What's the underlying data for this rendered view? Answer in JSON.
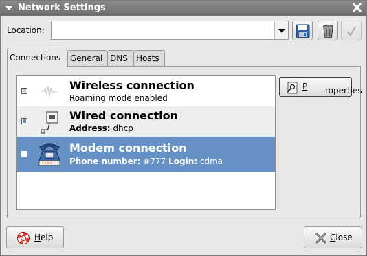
{
  "window": {
    "title": "Network Settings"
  },
  "location": {
    "label": "Location:",
    "value": ""
  },
  "toolbar": {
    "save_icon": "floppy-disk-icon",
    "delete_icon": "trash-can-icon",
    "apply_icon": "checkmark-icon"
  },
  "tabs": [
    {
      "label": "Connections",
      "active": true
    },
    {
      "label": "General",
      "active": false
    },
    {
      "label": "DNS",
      "active": false
    },
    {
      "label": "Hosts",
      "active": false
    }
  ],
  "connections": [
    {
      "title": "Wireless connection",
      "subtitle": "Roaming mode enabled",
      "state": "inconsistent",
      "icon": "wireless-icon"
    },
    {
      "title": "Wired connection",
      "subtitle_label": "Address:",
      "subtitle_value": "dhcp",
      "state": "checked",
      "icon": "ethernet-icon"
    },
    {
      "title": "Modem connection",
      "subtitle_label1": "Phone number:",
      "subtitle_value1": "#777",
      "subtitle_label2": "Login:",
      "subtitle_value2": "cdma",
      "state": "unchecked",
      "selected": true,
      "icon": "telephone-modem-icon"
    }
  ],
  "buttons": {
    "properties_prefix": "P",
    "properties_rest": "roperties",
    "help_prefix": "H",
    "help_rest": "elp",
    "close_prefix": "C",
    "close_rest": "lose"
  },
  "colors": {
    "selection": "#6591c4",
    "titlebar": "#7c7c7a"
  }
}
